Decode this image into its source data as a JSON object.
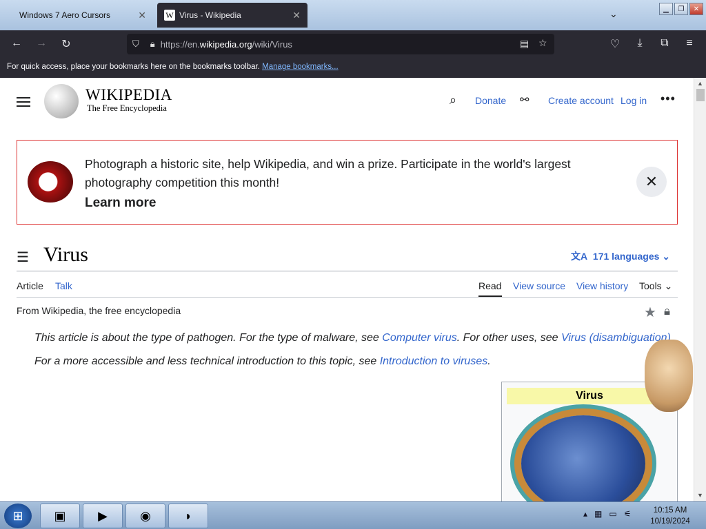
{
  "browser": {
    "tabs": [
      {
        "label": "Windows 7 Aero Cursors",
        "active": false
      },
      {
        "label": "Virus - Wikipedia",
        "active": true
      }
    ],
    "url_prefix": "https://en.",
    "url_domain": "wikipedia.org",
    "url_path": "/wiki/Virus",
    "bookmarks_text": "For quick access, place your bookmarks here on the bookmarks toolbar.",
    "bookmarks_link": "Manage bookmarks..."
  },
  "wiki": {
    "wordmark": "WIKIPEDIA",
    "tagline": "The Free Encyclopedia",
    "donate": "Donate",
    "create_account": "Create account",
    "login": "Log in",
    "banner_text": "Photograph a historic site, help Wikipedia, and win a prize. Participate in the world's largest photography competition this month!",
    "banner_cta": "Learn more",
    "title": "Virus",
    "languages": "171 languages",
    "tab_article": "Article",
    "tab_talk": "Talk",
    "tab_read": "Read",
    "tab_view_source": "View source",
    "tab_view_history": "View history",
    "tab_tools": "Tools",
    "from": "From Wikipedia, the free encyclopedia",
    "hatnote1_a": "This article is about the type of pathogen. For the type of malware, see ",
    "hatnote1_link1": "Computer virus",
    "hatnote1_b": ". For other uses, see ",
    "hatnote1_link2": "Virus (disambiguation)",
    "hatnote1_c": ".",
    "hatnote2_a": "For a more accessible and less technical introduction to this topic, see ",
    "hatnote2_link": "Introduction to viruses",
    "hatnote2_b": ".",
    "infobox_title": "Virus"
  },
  "taskbar": {
    "time": "10:15 AM",
    "date": "10/19/2024"
  }
}
